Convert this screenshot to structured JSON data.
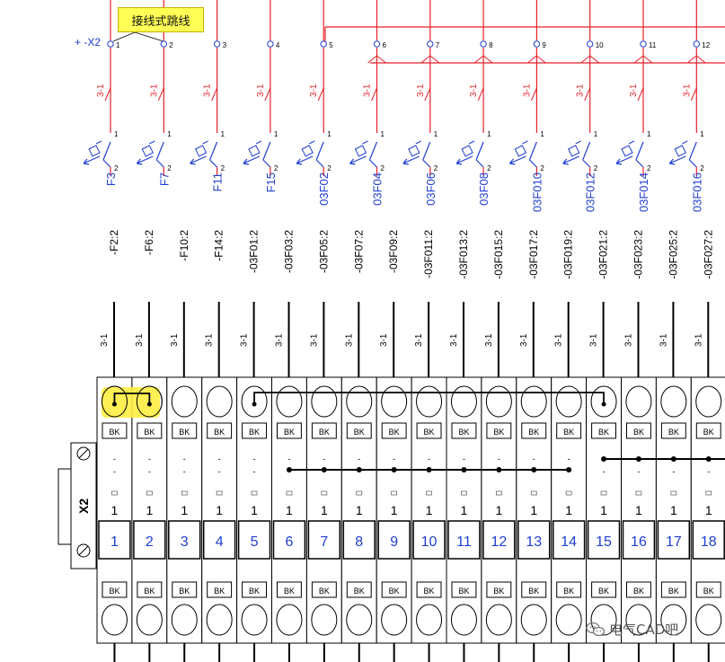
{
  "callout": {
    "text": "接线式跳线"
  },
  "strip": {
    "name": "X2",
    "ref": "+ -X2"
  },
  "circuit_columns": [
    {
      "terminal": "1",
      "breaker": "F3",
      "cross_ref": "3-1",
      "breaker_pins": [
        "1",
        "2"
      ]
    },
    {
      "terminal": "2",
      "breaker": "F7",
      "cross_ref": "3-1",
      "breaker_pins": [
        "1",
        "2"
      ]
    },
    {
      "terminal": "3",
      "breaker": "F11",
      "cross_ref": "3-1",
      "breaker_pins": [
        "1",
        "2"
      ]
    },
    {
      "terminal": "4",
      "breaker": "F15",
      "cross_ref": "3-1",
      "breaker_pins": [
        "1",
        "2"
      ]
    },
    {
      "terminal": "5",
      "breaker": "03F02",
      "cross_ref": "3-1",
      "breaker_pins": [
        "1",
        "2"
      ]
    },
    {
      "terminal": "6",
      "breaker": "03F04",
      "cross_ref": "3-1",
      "breaker_pins": [
        "1",
        "2"
      ]
    },
    {
      "terminal": "7",
      "breaker": "03F06",
      "cross_ref": "3-1",
      "breaker_pins": [
        "1",
        "2"
      ]
    },
    {
      "terminal": "8",
      "breaker": "03F08",
      "cross_ref": "3-1",
      "breaker_pins": [
        "1",
        "2"
      ]
    },
    {
      "terminal": "9",
      "breaker": "03F010",
      "cross_ref": "3-1",
      "breaker_pins": [
        "1",
        "2"
      ]
    },
    {
      "terminal": "10",
      "breaker": "03F012",
      "cross_ref": "3-1",
      "breaker_pins": [
        "1",
        "2"
      ]
    },
    {
      "terminal": "11",
      "breaker": "03F014",
      "cross_ref": "3-1",
      "breaker_pins": [
        "1",
        "2"
      ]
    },
    {
      "terminal": "12",
      "breaker": "03F016",
      "cross_ref": "3-1",
      "breaker_pins": [
        "1",
        "2"
      ]
    }
  ],
  "wires": [
    {
      "label": "-F2:2",
      "ref": "3-1"
    },
    {
      "label": "-F6:2",
      "ref": "3-1"
    },
    {
      "label": "-F10:2",
      "ref": "3-1"
    },
    {
      "label": "-F14:2",
      "ref": "3-1"
    },
    {
      "label": "-03F01:2",
      "ref": "3-1"
    },
    {
      "label": "-03F03:2",
      "ref": "3-1"
    },
    {
      "label": "-03F05:2",
      "ref": "3-1"
    },
    {
      "label": "-03F07:2",
      "ref": "3-1"
    },
    {
      "label": "-03F09:2",
      "ref": "3-1"
    },
    {
      "label": "-03F011:2",
      "ref": "3-1"
    },
    {
      "label": "-03F013:2",
      "ref": "3-1"
    },
    {
      "label": "-03F015:2",
      "ref": "3-1"
    },
    {
      "label": "-03F017:2",
      "ref": "3-1"
    },
    {
      "label": "-03F019:2",
      "ref": "3-1"
    },
    {
      "label": "-03F021:2",
      "ref": "3-1"
    },
    {
      "label": "-03F023:2",
      "ref": "3-1"
    },
    {
      "label": "-03F025:2",
      "ref": "3-1"
    },
    {
      "label": "-03F027:2",
      "ref": "3-1"
    }
  ],
  "terminals": [
    {
      "number": "1",
      "level": "1",
      "color_top": "BK",
      "color_bottom": "BK"
    },
    {
      "number": "2",
      "level": "1",
      "color_top": "BK",
      "color_bottom": "BK"
    },
    {
      "number": "3",
      "level": "1",
      "color_top": "BK",
      "color_bottom": "BK"
    },
    {
      "number": "4",
      "level": "1",
      "color_top": "BK",
      "color_bottom": "BK"
    },
    {
      "number": "5",
      "level": "1",
      "color_top": "BK",
      "color_bottom": "BK"
    },
    {
      "number": "6",
      "level": "1",
      "color_top": "BK",
      "color_bottom": "BK"
    },
    {
      "number": "7",
      "level": "1",
      "color_top": "BK",
      "color_bottom": "BK"
    },
    {
      "number": "8",
      "level": "1",
      "color_top": "BK",
      "color_bottom": "BK"
    },
    {
      "number": "9",
      "level": "1",
      "color_top": "BK",
      "color_bottom": "BK"
    },
    {
      "number": "10",
      "level": "1",
      "color_top": "BK",
      "color_bottom": "BK"
    },
    {
      "number": "11",
      "level": "1",
      "color_top": "BK",
      "color_bottom": "BK"
    },
    {
      "number": "12",
      "level": "1",
      "color_top": "BK",
      "color_bottom": "BK"
    },
    {
      "number": "13",
      "level": "1",
      "color_top": "BK",
      "color_bottom": "BK"
    },
    {
      "number": "14",
      "level": "1",
      "color_top": "BK",
      "color_bottom": "BK"
    },
    {
      "number": "15",
      "level": "1",
      "color_top": "BK",
      "color_bottom": "BK"
    },
    {
      "number": "16",
      "level": "1",
      "color_top": "BK",
      "color_bottom": "BK"
    },
    {
      "number": "17",
      "level": "1",
      "color_top": "BK",
      "color_bottom": "BK"
    },
    {
      "number": "18",
      "level": "1",
      "color_top": "BK",
      "color_bottom": "BK"
    }
  ],
  "watermark": {
    "text": "电气CAD吧",
    "icon": "wechat-icon"
  },
  "colors": {
    "schematic_red": "#e8202a",
    "label_blue": "#1f3ecf",
    "jumper_highlight": "#ffee44",
    "callout_bg": "#ffff55",
    "terminal_line": "#000000"
  }
}
